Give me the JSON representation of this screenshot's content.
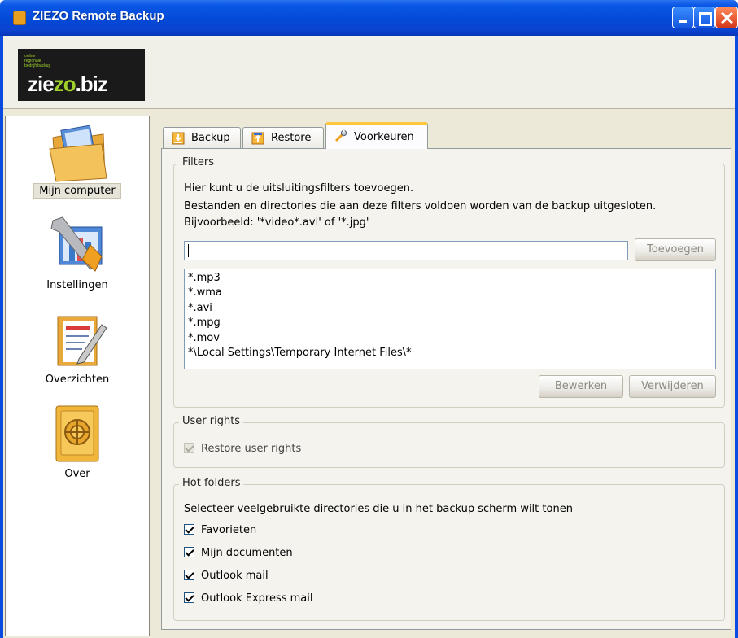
{
  "window": {
    "title": "ZIEZO Remote Backup"
  },
  "logo": {
    "small_lines": [
      "online",
      "regionale",
      "bedrijfsbackup"
    ],
    "zie": "zie",
    "zo": "zo",
    "biz": ".biz"
  },
  "sidebar": {
    "items": [
      {
        "label": "Mijn computer",
        "icon": "folder-icon",
        "active": true
      },
      {
        "label": "Instellingen",
        "icon": "tools-icon",
        "active": false
      },
      {
        "label": "Overzichten",
        "icon": "report-icon",
        "active": false
      },
      {
        "label": "Over",
        "icon": "safe-icon",
        "active": false
      }
    ]
  },
  "tabs": [
    {
      "label": "Backup",
      "icon": "backup-arrow-icon"
    },
    {
      "label": "Restore",
      "icon": "restore-arrow-icon"
    },
    {
      "label": "Voorkeuren",
      "icon": "wrench-icon",
      "active": true
    }
  ],
  "filters": {
    "legend": "Filters",
    "description": [
      "Hier kunt u de uitsluitingsfilters toevoegen.",
      "Bestanden en directories die aan deze filters voldoen worden van de backup uitgesloten.",
      "Bijvoorbeeld: '*video*.avi' of '*.jpg'"
    ],
    "input_value": "",
    "add_button": "Toevoegen",
    "items": [
      "*.mp3",
      "*.wma",
      "*.avi",
      "*.mpg",
      "*.mov",
      "*\\Local Settings\\Temporary Internet Files\\*"
    ],
    "edit_button": "Bewerken",
    "delete_button": "Verwijderen"
  },
  "user_rights": {
    "legend": "User rights",
    "restore_label": "Restore user rights",
    "restore_checked": true,
    "restore_disabled": true
  },
  "hot_folders": {
    "legend": "Hot folders",
    "description": "Selecteer veelgebruikte directories die u in het backup scherm wilt tonen",
    "items": [
      {
        "label": "Favorieten",
        "checked": true
      },
      {
        "label": "Mijn documenten",
        "checked": true
      },
      {
        "label": "Outlook mail",
        "checked": true
      },
      {
        "label": "Outlook Express mail",
        "checked": true
      }
    ]
  }
}
